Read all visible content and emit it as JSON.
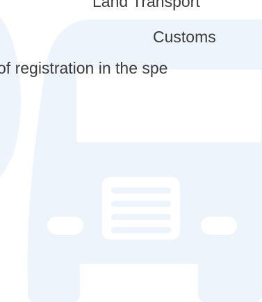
{
  "text": {
    "line_1": "Land Transport",
    "line_2": "Customs",
    "line_3": "of registration in the spe"
  },
  "colors": {
    "background": "#ffffff",
    "watermark": "#eef4fb",
    "watermark_detail": "#ffffff",
    "text": "#3c3c3c"
  },
  "icons": {
    "background": "truck-front-icon",
    "left_arc": "circle-arc-shape"
  }
}
